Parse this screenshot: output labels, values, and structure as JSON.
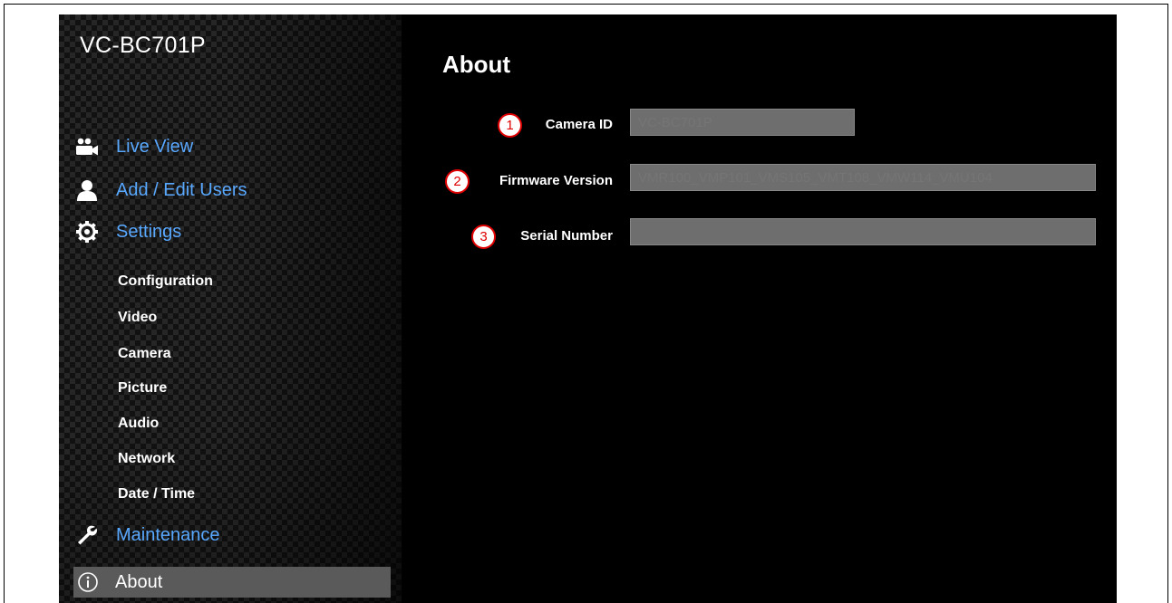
{
  "sidebar": {
    "model": "VC-BC701P",
    "main_items": [
      {
        "label": "Live View",
        "icon": "camera-icon"
      },
      {
        "label": "Add / Edit Users",
        "icon": "user-icon"
      },
      {
        "label": "Settings",
        "icon": "gear-icon"
      },
      {
        "label": "Maintenance",
        "icon": "wrench-icon"
      }
    ],
    "settings_items": [
      {
        "label": "Configuration"
      },
      {
        "label": "Video"
      },
      {
        "label": "Camera"
      },
      {
        "label": "Picture"
      },
      {
        "label": "Audio"
      },
      {
        "label": "Network"
      },
      {
        "label": "Date / Time"
      }
    ],
    "active_item": {
      "label": "About",
      "icon": "info-icon"
    }
  },
  "page": {
    "title": "About",
    "fields": [
      {
        "marker": "1",
        "label": "Camera ID",
        "value": ""
      },
      {
        "marker": "2",
        "label": "Firmware Version",
        "value": ""
      },
      {
        "marker": "3",
        "label": "Serial Number",
        "value": ""
      }
    ],
    "placeholders": {
      "camera_id": "VC-BC701P",
      "firmware_version": "VMR100_VMP101_VMS105_VMT108_VMW114_VMU104",
      "serial_number": ""
    }
  },
  "colors": {
    "background": "#000000",
    "nav_link": "#59a8ff",
    "active_bg": "#5a5a5a",
    "input_bg": "#6e6e6e",
    "marker": "#e00000"
  }
}
